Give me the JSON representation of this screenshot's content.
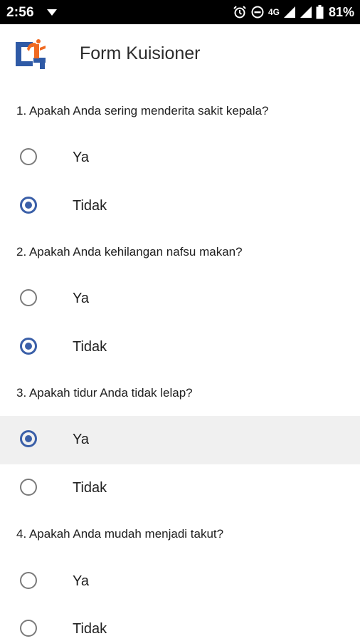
{
  "status_bar": {
    "time": "2:56",
    "network": "4G",
    "battery": "81%",
    "icons": [
      "dropdown-icon",
      "alarm-icon",
      "do-not-disturb-icon",
      "signal-icon",
      "signal-icon",
      "battery-icon"
    ]
  },
  "app_bar": {
    "title": "Form Kuisioner",
    "logo_icon": "app-logo"
  },
  "colors": {
    "accent": "#3a5fa8",
    "logo_orange": "#f06a22",
    "logo_blue": "#2f5aa6"
  },
  "questions": [
    {
      "text": "1. Apakah Anda sering menderita sakit kepala?",
      "options": [
        {
          "label": "Ya",
          "selected": false
        },
        {
          "label": "Tidak",
          "selected": true
        }
      ]
    },
    {
      "text": "2. Apakah Anda kehilangan nafsu makan?",
      "options": [
        {
          "label": "Ya",
          "selected": false
        },
        {
          "label": "Tidak",
          "selected": true
        }
      ]
    },
    {
      "text": "3. Apakah tidur Anda tidak lelap?",
      "options": [
        {
          "label": "Ya",
          "selected": true
        },
        {
          "label": "Tidak",
          "selected": false
        }
      ]
    },
    {
      "text": "4. Apakah Anda mudah menjadi takut?",
      "options": [
        {
          "label": "Ya",
          "selected": false
        },
        {
          "label": "Tidak",
          "selected": false
        }
      ]
    }
  ]
}
